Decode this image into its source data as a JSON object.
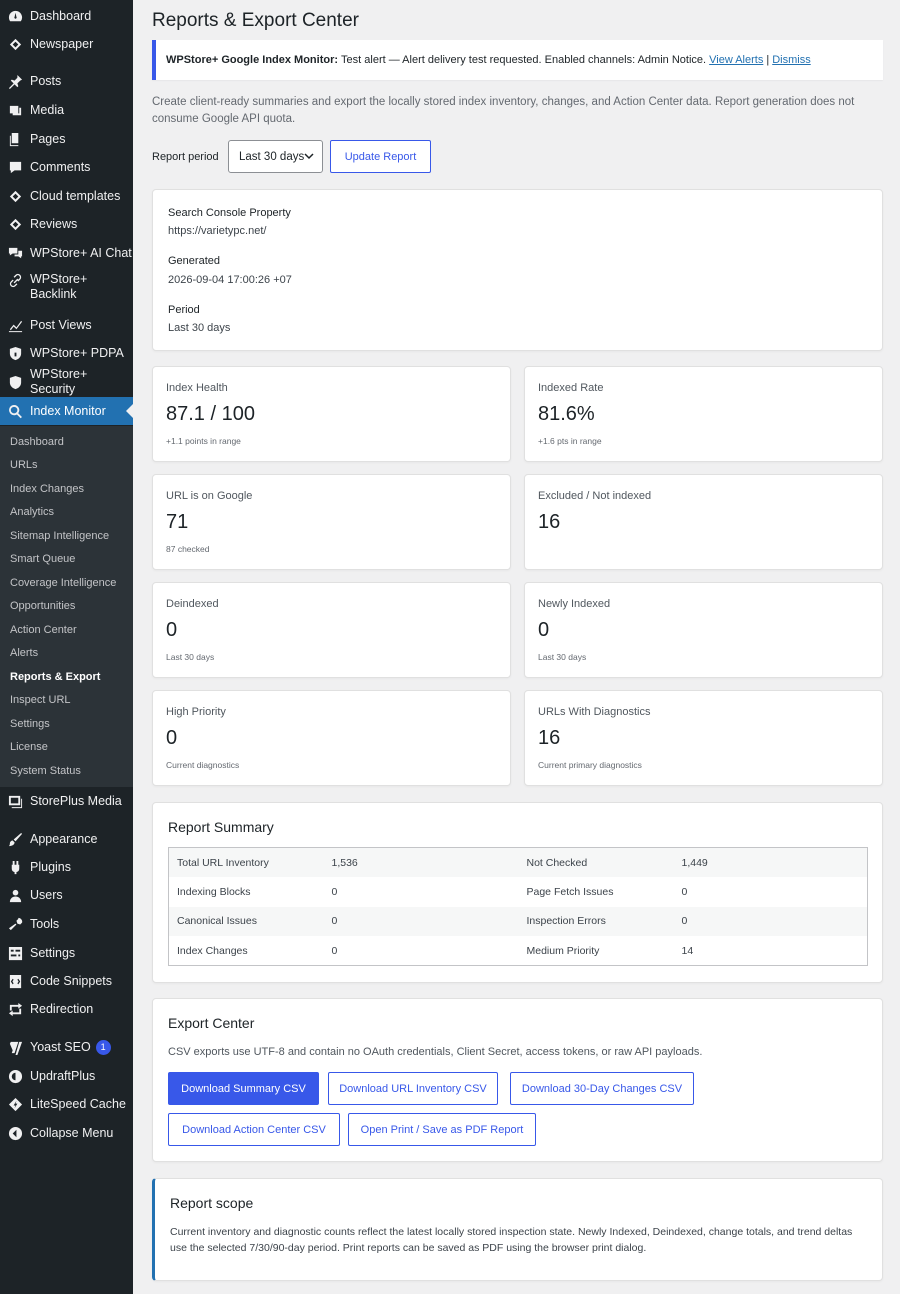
{
  "sidebar": {
    "items": [
      {
        "label": "Dashboard",
        "icon": "dashboard-icon"
      },
      {
        "label": "Newspaper",
        "icon": "newspaper-icon"
      },
      {
        "label": "Posts",
        "icon": "pin-icon"
      },
      {
        "label": "Media",
        "icon": "media-icon"
      },
      {
        "label": "Pages",
        "icon": "pages-icon"
      },
      {
        "label": "Comments",
        "icon": "comments-icon"
      },
      {
        "label": "Cloud templates",
        "icon": "cloud-templates-icon"
      },
      {
        "label": "Reviews",
        "icon": "reviews-icon"
      },
      {
        "label": "WPStore+ AI Chat",
        "icon": "chat-icon"
      },
      {
        "label": "WPStore+ Backlink",
        "icon": "link-icon"
      },
      {
        "label": "Post Views",
        "icon": "chart-icon"
      },
      {
        "label": "WPStore+ PDPA",
        "icon": "shield-lock-icon"
      },
      {
        "label": "WPStore+ Security",
        "icon": "shield-icon"
      },
      {
        "label": "Index Monitor",
        "icon": "search-icon"
      },
      {
        "label": "StorePlus Media",
        "icon": "storeplus-media-icon"
      },
      {
        "label": "Appearance",
        "icon": "brush-icon"
      },
      {
        "label": "Plugins",
        "icon": "plugin-icon"
      },
      {
        "label": "Users",
        "icon": "users-icon"
      },
      {
        "label": "Tools",
        "icon": "wrench-icon"
      },
      {
        "label": "Settings",
        "icon": "settings-icon"
      },
      {
        "label": "Code Snippets",
        "icon": "code-icon"
      },
      {
        "label": "Redirection",
        "icon": "redirect-icon"
      },
      {
        "label": "Yoast SEO",
        "icon": "yoast-icon",
        "badge": "1"
      },
      {
        "label": "UpdraftPlus",
        "icon": "updraft-icon"
      },
      {
        "label": "LiteSpeed Cache",
        "icon": "litespeed-icon"
      },
      {
        "label": "Collapse Menu",
        "icon": "collapse-icon"
      }
    ],
    "submenu": [
      "Dashboard",
      "URLs",
      "Index Changes",
      "Analytics",
      "Sitemap Intelligence",
      "Smart Queue",
      "Coverage Intelligence",
      "Opportunities",
      "Action Center",
      "Alerts",
      "Reports & Export",
      "Inspect URL",
      "Settings",
      "License",
      "System Status"
    ]
  },
  "page": {
    "title": "Reports & Export Center",
    "notice": {
      "bold": "WPStore+ Google Index Monitor:",
      "text": "Test alert — Alert delivery test requested. Enabled channels: Admin Notice.",
      "link_view": "View Alerts",
      "sep": "|",
      "link_dismiss": "Dismiss"
    },
    "intro": "Create client-ready summaries and export the locally stored index inventory, changes, and Action Center data. Report generation does not consume Google API quota.",
    "period_label": "Report period",
    "period_value": "Last 30 days",
    "update_button": "Update Report"
  },
  "meta": {
    "property_label": "Search Console Property",
    "property_value": "https://varietypc.net/",
    "generated_label": "Generated",
    "generated_value": "2026-09-04 17:00:26 +07",
    "period_label": "Period",
    "period_value": "Last 30 days"
  },
  "stats": [
    {
      "label": "Index Health",
      "value": "87.1 / 100",
      "sub": "+1.1 points in range"
    },
    {
      "label": "Indexed Rate",
      "value": "81.6%",
      "sub": "+1.6 pts in range"
    },
    {
      "label": "URL is on Google",
      "value": "71",
      "sub": "87 checked"
    },
    {
      "label": "Excluded / Not indexed",
      "value": "16",
      "sub": ""
    },
    {
      "label": "Deindexed",
      "value": "0",
      "sub": "Last 30 days"
    },
    {
      "label": "Newly Indexed",
      "value": "0",
      "sub": "Last 30 days"
    },
    {
      "label": "High Priority",
      "value": "0",
      "sub": "Current diagnostics"
    },
    {
      "label": "URLs With Diagnostics",
      "value": "16",
      "sub": "Current primary diagnostics"
    }
  ],
  "summary": {
    "title": "Report Summary",
    "rows": [
      [
        "Total URL Inventory",
        "1,536",
        "Not Checked",
        "1,449"
      ],
      [
        "Indexing Blocks",
        "0",
        "Page Fetch Issues",
        "0"
      ],
      [
        "Canonical Issues",
        "0",
        "Inspection Errors",
        "0"
      ],
      [
        "Index Changes",
        "0",
        "Medium Priority",
        "14"
      ]
    ]
  },
  "export": {
    "title": "Export Center",
    "description": "CSV exports use UTF-8 and contain no OAuth credentials, Client Secret, access tokens, or raw API payloads.",
    "buttons": [
      "Download Summary CSV",
      "Download URL Inventory CSV",
      "Download 30-Day Changes CSV",
      "Download Action Center CSV",
      "Open Print / Save as PDF Report"
    ]
  },
  "scope": {
    "title": "Report scope",
    "text": "Current inventory and diagnostic counts reflect the latest locally stored inspection state. Newly Indexed, Deindexed, change totals, and trend deltas use the selected 7/30/90-day period. Print reports can be saved as PDF using the browser print dialog."
  },
  "colors": {
    "sidebar_bg": "#1d2327",
    "submenu_bg": "#2c3338",
    "active_menu": "#2271b1",
    "accent": "#3858e9",
    "page_bg": "#f0f0f1"
  }
}
